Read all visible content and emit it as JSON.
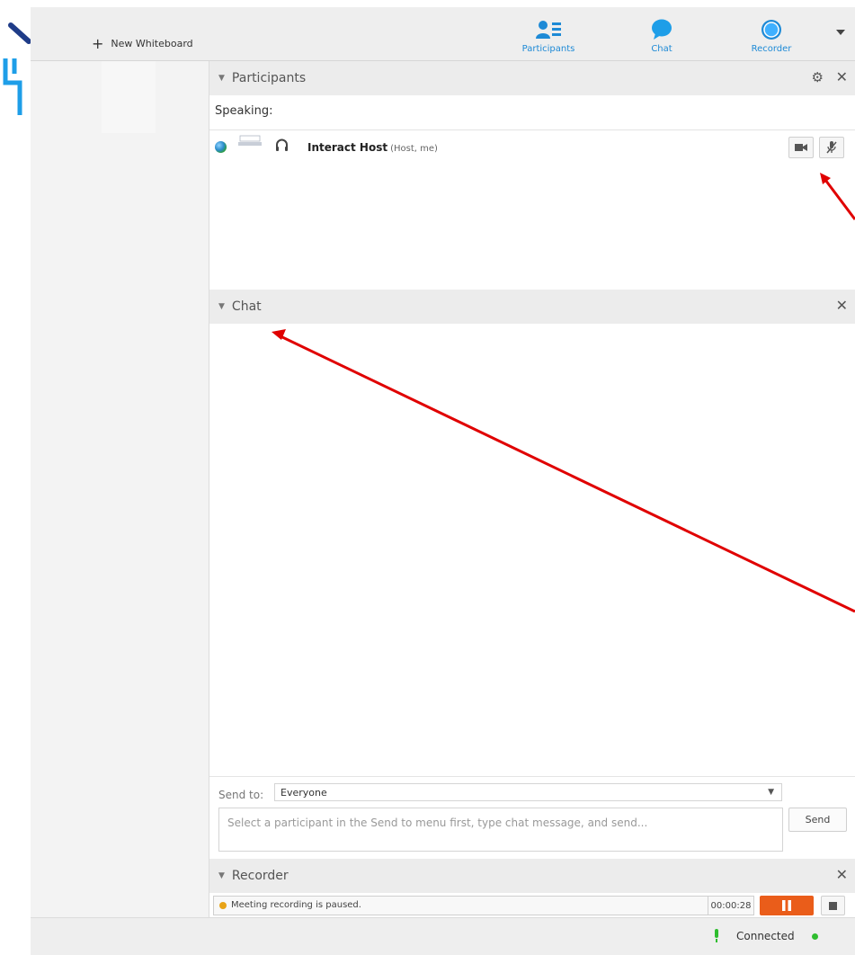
{
  "toolbar": {
    "new_whiteboard_label": "New Whiteboard",
    "buttons": [
      {
        "label": "Participants",
        "icon": "participants-icon"
      },
      {
        "label": "Chat",
        "icon": "chat-bubble-icon"
      },
      {
        "label": "Recorder",
        "icon": "recorder-icon"
      }
    ],
    "accent_color": "#1e8ad6"
  },
  "participants_panel": {
    "title": "Participants",
    "speaking_label": "Speaking:",
    "participants": [
      {
        "name": "Interact Host",
        "role": "(Host, me)"
      }
    ]
  },
  "chat_panel": {
    "title": "Chat",
    "send_to_label": "Send to:",
    "send_to_value": "Everyone",
    "input_placeholder": "Select a participant in the Send to menu first, type chat message, and send...",
    "send_label": "Send"
  },
  "recorder_panel": {
    "title": "Recorder",
    "status_text": "Meeting recording is paused.",
    "elapsed": "00:00:28",
    "pause_color": "#ea5d1a",
    "status_dot_color": "#e8a317"
  },
  "status_bar": {
    "connection_text": "Connected",
    "connection_color": "#2fbd2f"
  }
}
